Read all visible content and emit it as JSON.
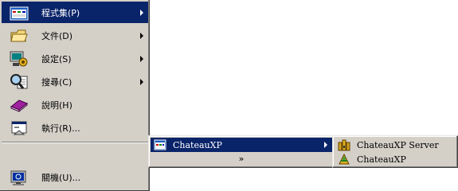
{
  "start_menu": {
    "items": [
      {
        "label": "程式集(P)",
        "icon": "programs-icon",
        "has_submenu": true,
        "selected": true
      },
      {
        "label": "文件(D)",
        "icon": "documents-icon",
        "has_submenu": true
      },
      {
        "label": "設定(S)",
        "icon": "settings-icon",
        "has_submenu": true
      },
      {
        "label": "搜尋(C)",
        "icon": "search-icon",
        "has_submenu": true
      },
      {
        "label": "說明(H)",
        "icon": "help-icon",
        "has_submenu": false
      },
      {
        "label": "執行(R)...",
        "icon": "run-icon",
        "has_submenu": false
      },
      {
        "label": "關機(U)...",
        "icon": "shutdown-icon",
        "has_submenu": false
      }
    ]
  },
  "programs_submenu": {
    "items": [
      {
        "label": "ChateauXP",
        "icon": "program-group-icon",
        "has_submenu": true,
        "selected": true
      }
    ],
    "expand_symbol": "»"
  },
  "chateau_submenu": {
    "items": [
      {
        "label": "ChateauXP Server",
        "icon": "chateau-server-icon"
      },
      {
        "label": "ChateauXP",
        "icon": "chateau-app-icon"
      }
    ]
  },
  "colors": {
    "menu_bg": "#d4d0c8",
    "highlight": "#0a246a",
    "highlight_text": "#ffffff"
  }
}
